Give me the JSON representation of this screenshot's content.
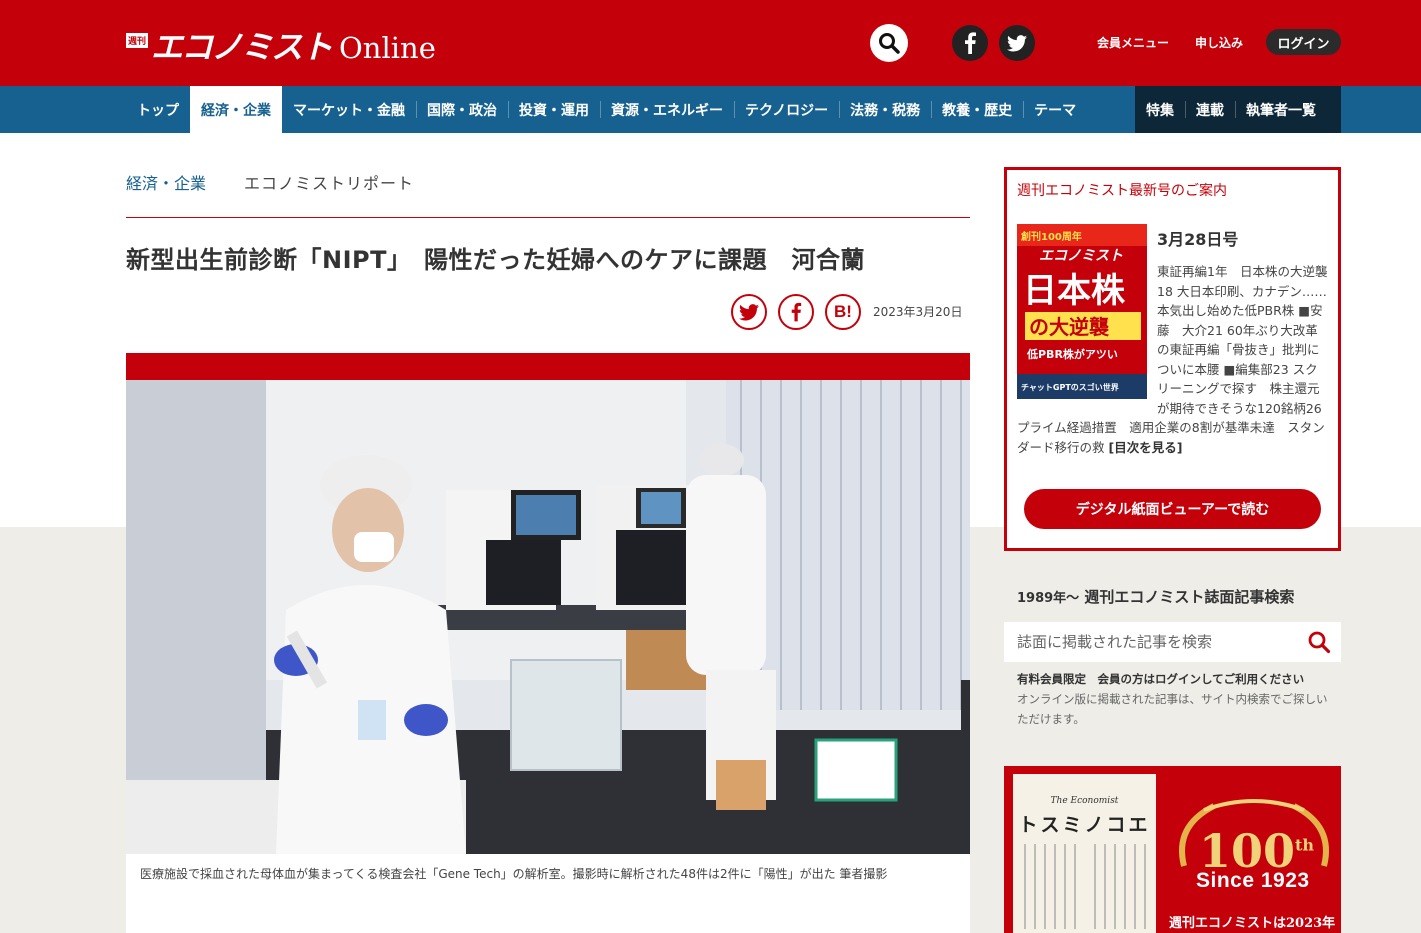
{
  "header": {
    "logo_mark": "週刊",
    "logo_main": "エコノミスト",
    "logo_online": "Online",
    "member_menu": "会員メニュー",
    "apply": "申し込み",
    "login": "ログイン",
    "icons": [
      "search-icon",
      "facebook-icon",
      "twitter-icon"
    ]
  },
  "nav": {
    "items": [
      "トップ",
      "経済・企業",
      "マーケット・金融",
      "国際・政治",
      "投資・運用",
      "資源・エネルギー",
      "テクノロジー",
      "法務・税務",
      "教養・歴史",
      "テーマ"
    ],
    "active": "経済・企業",
    "right_items": [
      "特集",
      "連載",
      "執筆者一覧"
    ]
  },
  "article": {
    "category": "経済・企業",
    "series": "エコノミストリポート",
    "title": "新型出生前診断「NIPT」　陽性だった妊婦へのケアに課題　河合蘭",
    "date": "2023年3月20日",
    "share_hatena": "B!",
    "caption": "医療施設で採血された母体血が集まってくる検査会社「Gene Tech」の解析室。撮影時に解析された48件は2件に「陽性」が出た 筆者撮影"
  },
  "sidebar": {
    "issue_heading": "週刊エコノミスト最新号のご案内",
    "issue_date": "3月28日号",
    "issue_summary": "東証再編1年　日本株の大逆襲18 大日本印刷、カナデン…… 本気出し始めた低PBR株 ■安藤　大介21 60年ぶり大改革の東証再編「骨抜き」批判についに本腰 ■編集部23 スクリーニングで探す　株主還元が期待できそうな120銘柄26 プライム経過措置　適用企業の8割が基準未達　スタンダード移行の救 ",
    "issue_more": "[目次を見る]",
    "viewer_button": "デジタル紙面ビューアーで読む",
    "search_title_prefix": "1989年〜",
    "search_title": "週刊エコノミスト誌面記事検索",
    "search_placeholder": "誌面に掲載された記事を検索",
    "member_note_1": "有料会員限定　会員の方はログインしてご利用ください",
    "member_note_2": "オンライン版に掲載された記事は、サイト内検索でご探しいただけます。",
    "cover": {
      "badge": "創刊100周年",
      "masthead": "エコノミスト",
      "headline_1": "日本株",
      "headline_2": "の大逆襲",
      "sub": "低PBR株がアツい",
      "corner": "チャットGPTのスゴい世界"
    },
    "banner": {
      "paper_en": "The Economist",
      "paper_title": "トスミノコエ",
      "number": "100",
      "suffix": "th",
      "since": "Since 1923",
      "bottom": "週刊エコノミストは2023年"
    }
  },
  "colors": {
    "brand_red": "#c4000a",
    "nav_blue": "#16618f",
    "nav_dark": "#0e2738"
  }
}
